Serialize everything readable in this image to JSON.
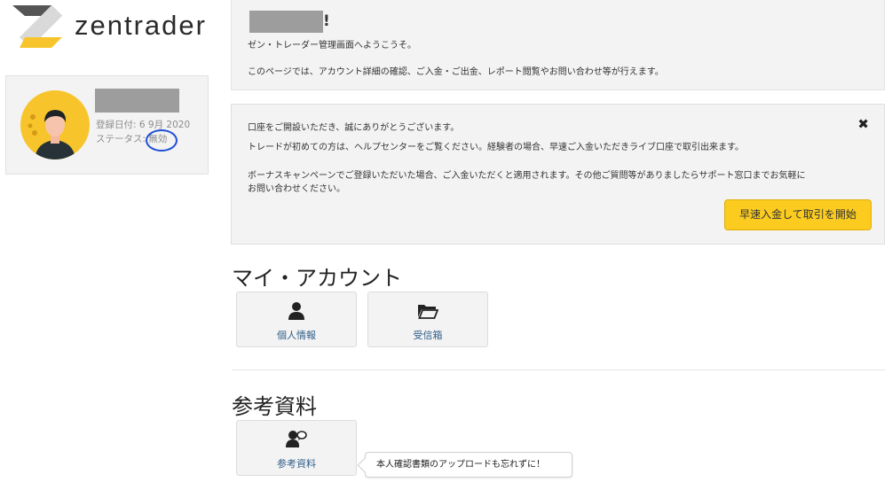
{
  "logo": {
    "text": "zentrader"
  },
  "profile": {
    "registered": "登録日付: 6 9月 2020",
    "status_prefix": "ステータス: ",
    "status_value": "無効"
  },
  "welcome": {
    "exclaim": "!",
    "line1": "ゼン・トレーダー管理画面へようこうそ。",
    "line2": "このページでは、アカウント詳細の確認、ご入金・ご出金、レポート閲覧やお問い合わせ等が行えます。"
  },
  "notice": {
    "line1": "口座をご開設いただき、誠にありがとうございます。",
    "line2": "トレードが初めての方は、ヘルプセンターをご覧ください。経験者の場合、早速ご入金いただきライブ口座で取引出来ます。",
    "line3": "ボーナスキャンペーンでご登録いただいた場合、ご入金いただくと適用されます。その他ご質問等がありましたらサポート窓口までお気軽に",
    "line4": "お問い合わせください。",
    "close": "✖",
    "deposit_button": "早速入金して取引を開始"
  },
  "my_account": {
    "title": "マイ・アカウント",
    "tiles": [
      {
        "label": "個人情報",
        "icon": "user-icon"
      },
      {
        "label": "受信箱",
        "icon": "folder-icon"
      }
    ]
  },
  "references": {
    "title": "参考資料",
    "tiles": [
      {
        "label": "参考資料",
        "icon": "user-chat-icon"
      }
    ],
    "tooltip": "本人確認書類のアップロードも忘れずに！"
  },
  "colors": {
    "accent": "#fbcc1f",
    "link": "#2f5f8a",
    "panel": "#f3f3f3",
    "annotation": "#1f4ed6"
  }
}
